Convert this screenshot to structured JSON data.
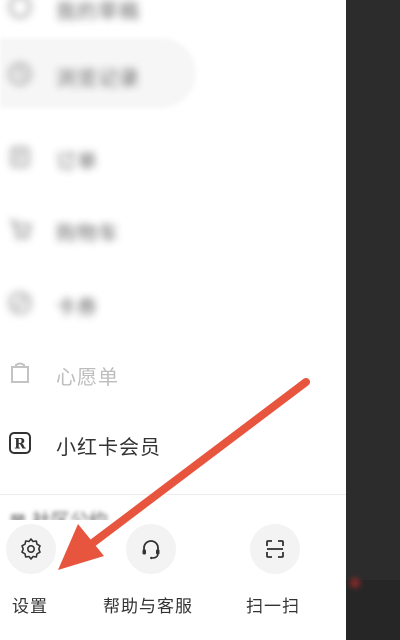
{
  "menu": {
    "items": [
      {
        "label": "我的草稿",
        "icon": "drafts-icon",
        "state": "blurred"
      },
      {
        "label": "浏览记录",
        "icon": "history-icon",
        "state": "blurred"
      },
      {
        "label": "订单",
        "icon": "order-icon",
        "state": "blurred"
      },
      {
        "label": "购物车",
        "icon": "cart-icon",
        "state": "blurred"
      },
      {
        "label": "卡券",
        "icon": "coupon-icon",
        "state": "blurred"
      },
      {
        "label": "心愿单",
        "icon": "wishlist-icon",
        "state": "faded"
      },
      {
        "label": "小红卡会员",
        "icon": "r-card-icon",
        "state": "normal"
      }
    ],
    "partial_item": "⊠ 社区公约"
  },
  "bottom_bar": {
    "settings_label": "设置",
    "help_label": "帮助与客服",
    "scan_label": "扫一扫"
  },
  "colors": {
    "arrow": "#e8553f",
    "text": "#333333",
    "faded_text": "#bdbdbd",
    "overlay": "#2c2c2c"
  }
}
